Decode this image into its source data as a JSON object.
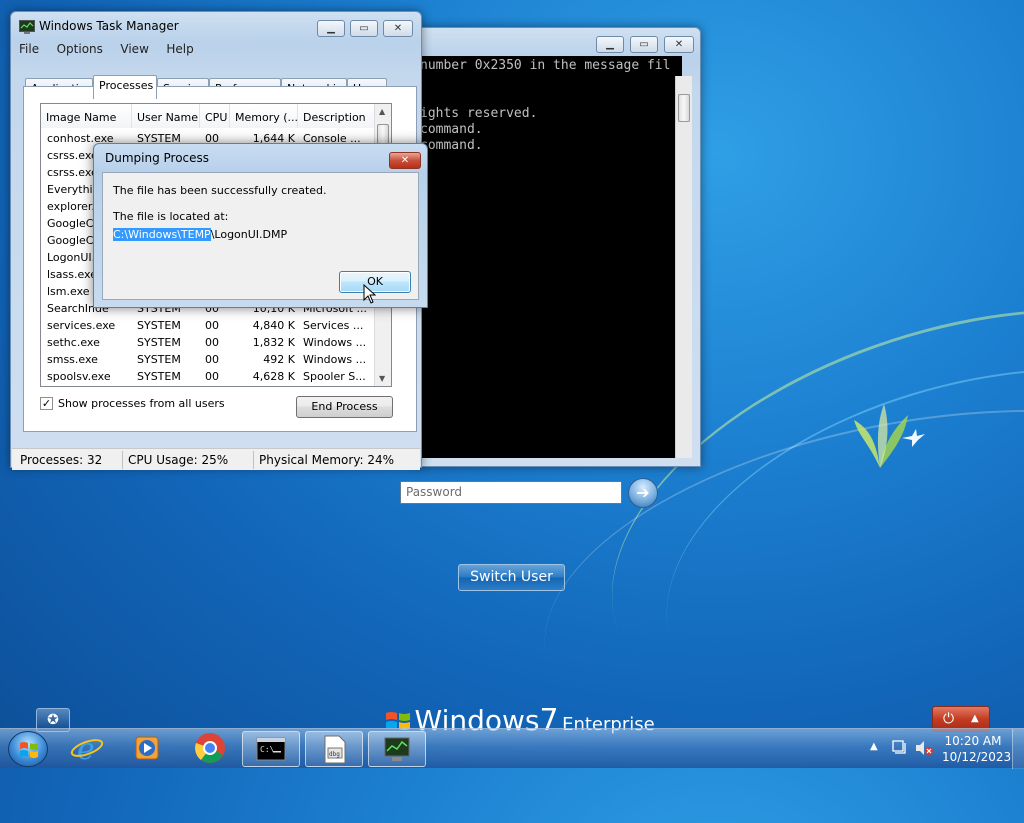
{
  "cmd": {
    "lines": [
      "number 0x2350 in the message fil",
      "",
      "",
      "ights reserved.",
      "command.",
      "command."
    ]
  },
  "taskmgr": {
    "title": "Windows Task Manager",
    "menu": [
      "File",
      "Options",
      "View",
      "Help"
    ],
    "tabs": [
      "Applications",
      "Processes",
      "Services",
      "Performance",
      "Networking",
      "Users"
    ],
    "active_tab": "Processes",
    "columns": [
      "Image Name",
      "User Name",
      "CPU",
      "Memory (...",
      "Description"
    ],
    "rows": [
      [
        "conhost.exe",
        "SYSTEM",
        "00",
        "1,644 K",
        "Console ..."
      ],
      [
        "csrss.exe",
        "",
        "",
        "",
        ""
      ],
      [
        "csrss.exe",
        "",
        "",
        "",
        ""
      ],
      [
        "Everythin",
        "",
        "",
        "",
        ""
      ],
      [
        "explorer.",
        "",
        "",
        "",
        ""
      ],
      [
        "GoogleCr",
        "",
        "",
        "",
        ""
      ],
      [
        "GoogleCr",
        "",
        "",
        "",
        ""
      ],
      [
        "LogonUI.",
        "",
        "",
        "",
        ""
      ],
      [
        "lsass.exe",
        "",
        "",
        "",
        ""
      ],
      [
        "lsm.exe",
        "",
        "",
        "",
        ""
      ],
      [
        "SearchInde",
        "SYSTEM",
        "00",
        "10,10 K",
        "Microsoft ..."
      ],
      [
        "services.exe",
        "SYSTEM",
        "00",
        "4,840 K",
        "Services ..."
      ],
      [
        "sethc.exe",
        "SYSTEM",
        "00",
        "1,832 K",
        "Windows ..."
      ],
      [
        "smss.exe",
        "SYSTEM",
        "00",
        "492 K",
        "Windows ..."
      ],
      [
        "spoolsv.exe",
        "SYSTEM",
        "00",
        "4,628 K",
        "Spooler S..."
      ]
    ],
    "show_all_label": "Show processes from all users",
    "show_all_checked": "✓",
    "end_process_label": "End Process",
    "status": {
      "processes": "Processes: 32",
      "cpu": "CPU Usage: 25%",
      "memory": "Physical Memory: 24%"
    }
  },
  "dialog": {
    "title": "Dumping Process",
    "message": "The file has been successfully created.",
    "location_label": "The file is located at:",
    "path_selected": "C:\\Windows\\TEMP",
    "path_rest": "\\LogonUI.DMP",
    "ok_label": "OK"
  },
  "logon": {
    "password_placeholder": "Password",
    "switch_user_label": "Switch User",
    "brand_windows": "Windows",
    "brand_version": "7",
    "brand_edition": "Enterprise"
  },
  "taskbar": {
    "time": "10:20 AM",
    "date": "10/12/2023",
    "items": [
      "internet-explorer-icon",
      "media-player-icon",
      "chrome-icon",
      "command-prompt-icon",
      "file-icon",
      "task-manager-icon"
    ]
  },
  "colors": {
    "selection": "#3399ff",
    "desktop": "#1c7fd0"
  }
}
